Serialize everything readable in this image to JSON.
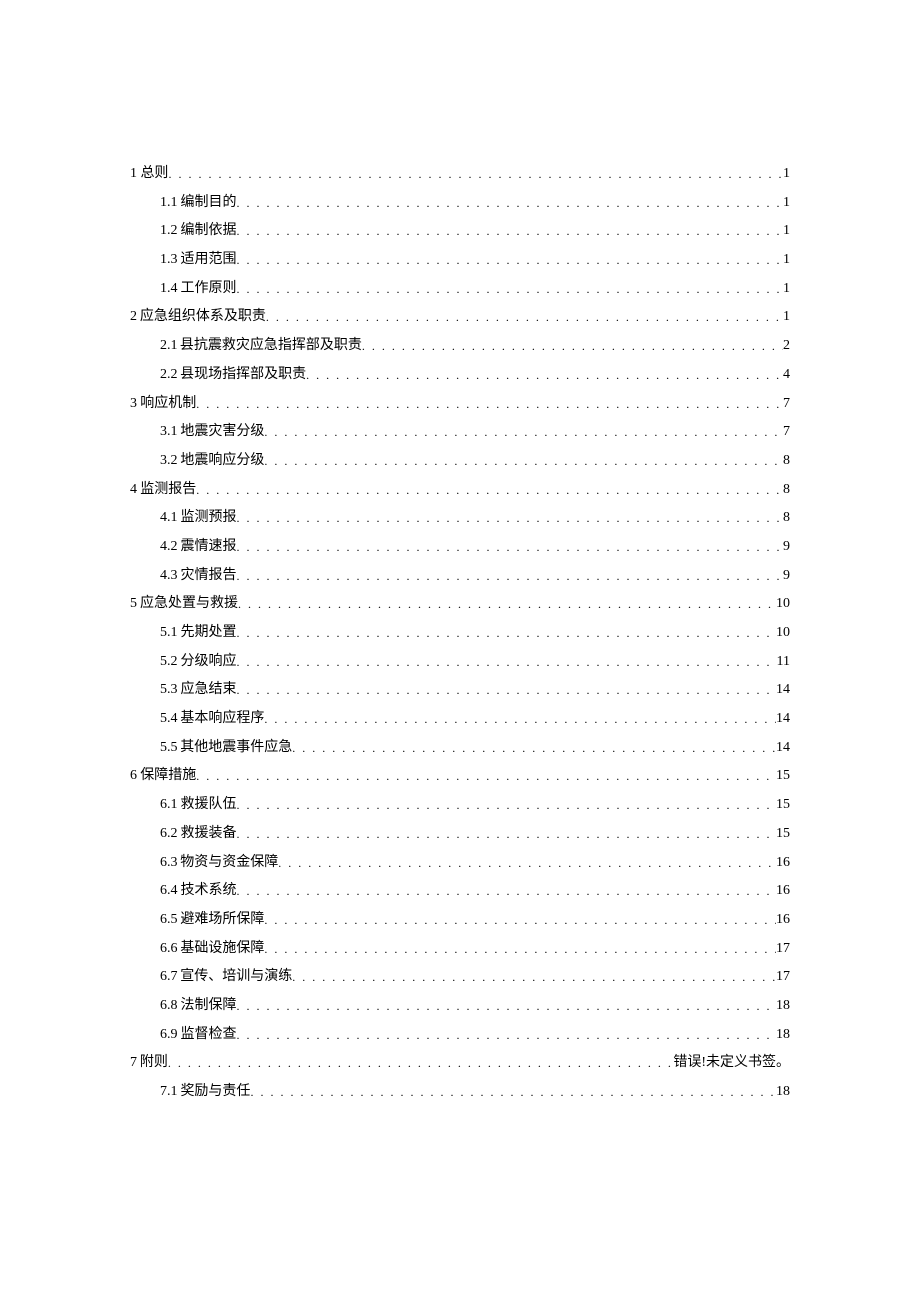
{
  "toc": [
    {
      "level": 1,
      "num": "1",
      "title": "总则",
      "page": "1"
    },
    {
      "level": 2,
      "num": "1.1",
      "title": "编制目的",
      "page": "1"
    },
    {
      "level": 2,
      "num": "1.2",
      "title": "编制依据",
      "page": "1"
    },
    {
      "level": 2,
      "num": "1.3",
      "title": "适用范围",
      "page": "1"
    },
    {
      "level": 2,
      "num": "1.4",
      "title": "工作原则",
      "page": "1"
    },
    {
      "level": 1,
      "num": "2",
      "title": "应急组织体系及职责",
      "page": "1"
    },
    {
      "level": 2,
      "num": "2.1",
      "title": "县抗震救灾应急指挥部及职责",
      "page": "2"
    },
    {
      "level": 2,
      "num": "2.2",
      "title": "县现场指挥部及职责",
      "page": "4"
    },
    {
      "level": 1,
      "num": "3",
      "title": "响应机制",
      "page": "7"
    },
    {
      "level": 2,
      "num": "3.1",
      "title": "地震灾害分级",
      "page": "7"
    },
    {
      "level": 2,
      "num": "3.2",
      "title": "地震响应分级",
      "page": "8"
    },
    {
      "level": 1,
      "num": "4",
      "title": "监测报告",
      "page": "8"
    },
    {
      "level": 2,
      "num": "4.1",
      "title": "监测预报",
      "page": "8"
    },
    {
      "level": 2,
      "num": "4.2",
      "title": "震情速报",
      "page": "9"
    },
    {
      "level": 2,
      "num": "4.3",
      "title": "灾情报告",
      "page": "9"
    },
    {
      "level": 1,
      "num": "5",
      "title": "应急处置与救援",
      "page": "10"
    },
    {
      "level": 2,
      "num": "5.1",
      "title": "先期处置",
      "page": "10"
    },
    {
      "level": 2,
      "num": "5.2",
      "title": "分级响应",
      "page": "11"
    },
    {
      "level": 2,
      "num": "5.3",
      "title": "应急结束",
      "page": "14"
    },
    {
      "level": 2,
      "num": "5.4",
      "title": "基本响应程序",
      "page": "14"
    },
    {
      "level": 2,
      "num": "5.5",
      "title": "其他地震事件应急",
      "page": "14"
    },
    {
      "level": 1,
      "num": "6",
      "title": "保障措施",
      "page": "15"
    },
    {
      "level": 2,
      "num": "6.1",
      "title": "救援队伍",
      "page": "15"
    },
    {
      "level": 2,
      "num": "6.2",
      "title": "救援装备",
      "page": "15"
    },
    {
      "level": 2,
      "num": "6.3",
      "title": "物资与资金保障",
      "page": "16"
    },
    {
      "level": 2,
      "num": "6.4",
      "title": "技术系统",
      "page": "16"
    },
    {
      "level": 2,
      "num": "6.5",
      "title": "避难场所保障",
      "page": "16"
    },
    {
      "level": 2,
      "num": "6.6",
      "title": "基础设施保障",
      "page": "17"
    },
    {
      "level": 2,
      "num": "6.7",
      "title": "宣传、培训与演练",
      "page": "17"
    },
    {
      "level": 2,
      "num": "6.8",
      "title": "法制保障",
      "page": "18"
    },
    {
      "level": 2,
      "num": "6.9",
      "title": "监督检查",
      "page": "18"
    },
    {
      "level": 1,
      "num": "7",
      "title": "附则",
      "page": "错误!未定义书签。"
    },
    {
      "level": 2,
      "num": "7.1",
      "title": "奖励与责任",
      "page": "18"
    }
  ],
  "dots_fill": ". . . . . . . . . . . . . . . . . . . . . . . . . . . . . . . . . . . . . . . . . . . . . . . . . . . . . . . . . . . . . . . . . . . . . . . . . . . . . . . . . . . . . . . . . . . . . . . . . . . . . . . . . . . ."
}
